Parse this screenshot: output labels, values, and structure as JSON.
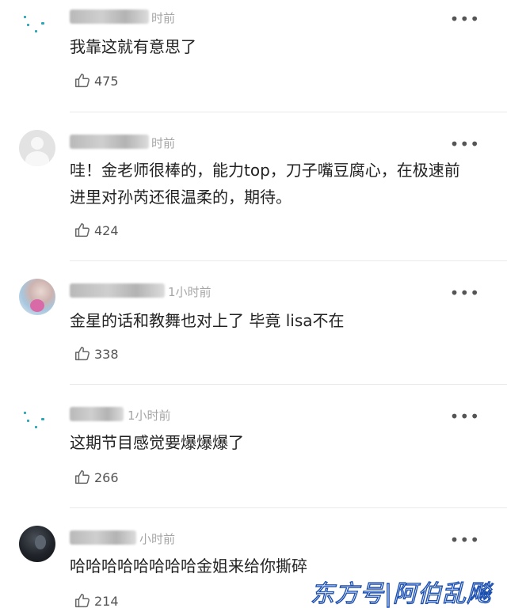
{
  "comments": [
    {
      "time": "时前",
      "text": "我靠这就有意思了",
      "likes": "475",
      "avatar": "teal-dots"
    },
    {
      "time": "时前",
      "text": "哇！金老师很棒的，能力top，刀子嘴豆腐心，在极速前进里对孙芮还很温柔的，期待。",
      "likes": "424",
      "avatar": "grey-default"
    },
    {
      "time": "1小时前",
      "text": "金星的话和教舞也对上了 毕竟 lisa不在",
      "likes": "338",
      "avatar": "photo-pink"
    },
    {
      "time": "1小时前",
      "text": "这期节目感觉要爆爆爆了",
      "likes": "266",
      "avatar": "teal-dots"
    },
    {
      "time": "小时前",
      "text": "哈哈哈哈哈哈哈哈金姐来给你撕碎",
      "likes": "214",
      "avatar": "photo-dark"
    }
  ],
  "more_label": "•••",
  "watermark": "东方号|阿伯乱飚",
  "colors": {
    "time": "#a6a6a6",
    "text": "#222222",
    "divider": "#e9e9e9",
    "watermark_stroke": "#1b4fb0"
  },
  "icons": {
    "like": "thumbs-up-icon",
    "more": "more-dots-icon"
  }
}
